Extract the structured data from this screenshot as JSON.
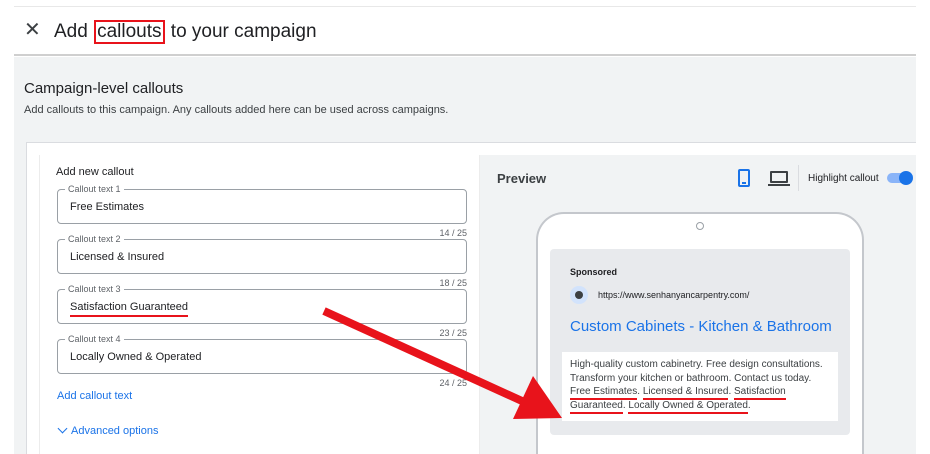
{
  "header": {
    "title_prefix": "Add ",
    "title_highlight": "callouts",
    "title_suffix": " to your campaign",
    "close_icon": "close-icon"
  },
  "section": {
    "title": "Campaign-level callouts",
    "description": "Add callouts to this campaign. Any callouts added here can be used across campaigns."
  },
  "form": {
    "add_title": "Add new callout",
    "fields": [
      {
        "label": "Callout text 1",
        "value": "Free Estimates",
        "counter": "14 / 25"
      },
      {
        "label": "Callout text 2",
        "value": "Licensed & Insured",
        "counter": "18 / 25"
      },
      {
        "label": "Callout text 3",
        "value": "Satisfaction Guaranteed",
        "counter": "23 / 25"
      },
      {
        "label": "Callout text 4",
        "value": "Locally Owned & Operated",
        "counter": "24 / 25"
      }
    ],
    "add_link": "Add callout text",
    "advanced_link": "Advanced options"
  },
  "preview": {
    "title": "Preview",
    "highlight_label": "Highlight callout",
    "highlight_on": true,
    "ad": {
      "sponsored": "Sponsored",
      "url": "https://www.senhanyancarpentry.com/",
      "headline": "Custom Cabinets - Kitchen & Bathroom",
      "desc_text": "High-quality custom cabinetry. Free design consultations. Transform your kitchen or bathroom. Contact us today.",
      "callouts": [
        "Free Estimates",
        "Licensed & Insured",
        "Satisfaction Guaranteed",
        "Locally Owned & Operated"
      ]
    }
  },
  "colors": {
    "accent": "#1a73e8",
    "annotation": "#e8131b"
  }
}
